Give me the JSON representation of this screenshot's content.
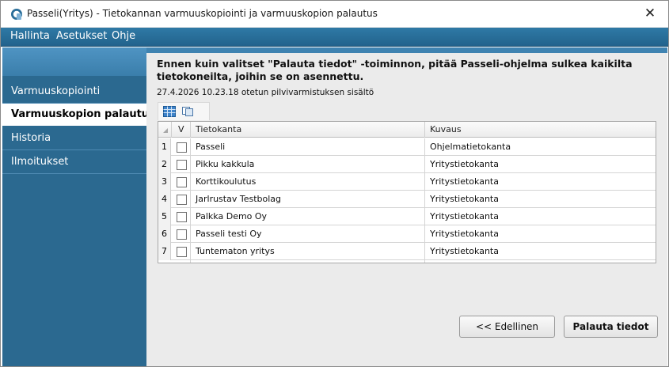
{
  "window": {
    "title": "Passeli(Yritys) - Tietokannan varmuuskopiointi ja varmuuskopion palautus",
    "close_glyph": "✕"
  },
  "menu": [
    "Hallinta",
    "Asetukset",
    "Ohje"
  ],
  "sidebar": {
    "items": [
      {
        "label": "Varmuuskopiointi",
        "active": false
      },
      {
        "label": "Varmuuskopion palautus",
        "active": true
      },
      {
        "label": "Historia",
        "active": false
      },
      {
        "label": "Ilmoitukset",
        "active": false
      }
    ]
  },
  "main": {
    "warning": "Ennen kuin valitset \"Palauta tiedot\" -toiminnon, pitää Passeli-ohjelma sulkea kaikilta tietokoneilta, joihin se on asennettu.",
    "backup_info": "27.4.2026 10.23.18 otetun pilvivarmistuksen sisältö",
    "toolbar_icons": [
      "grid-view-icon",
      "copy-icon"
    ]
  },
  "table": {
    "headers": {
      "check": "V",
      "database": "Tietokanta",
      "description": "Kuvaus"
    },
    "rows": [
      {
        "num": "1",
        "checked": false,
        "database": "Passeli",
        "description": "Ohjelmatietokanta"
      },
      {
        "num": "2",
        "checked": false,
        "database": "Pikku kakkula",
        "description": "Yritystietokanta"
      },
      {
        "num": "3",
        "checked": false,
        "database": "Korttikoulutus",
        "description": "Yritystietokanta"
      },
      {
        "num": "4",
        "checked": false,
        "database": "Jarlrustav Testbolag",
        "description": "Yritystietokanta"
      },
      {
        "num": "5",
        "checked": false,
        "database": "Palkka Demo Oy",
        "description": "Yritystietokanta"
      },
      {
        "num": "6",
        "checked": false,
        "database": "Passeli testi Oy",
        "description": "Yritystietokanta"
      },
      {
        "num": "7",
        "checked": false,
        "database": "Tuntematon yritys",
        "description": "Yritystietokanta"
      }
    ]
  },
  "buttons": {
    "previous": "<< Edellinen",
    "restore": "Palauta tiedot"
  },
  "colors": {
    "menubar": "#2a6e99",
    "sidebar": "#2b6990",
    "accent": "#3f83b1"
  }
}
